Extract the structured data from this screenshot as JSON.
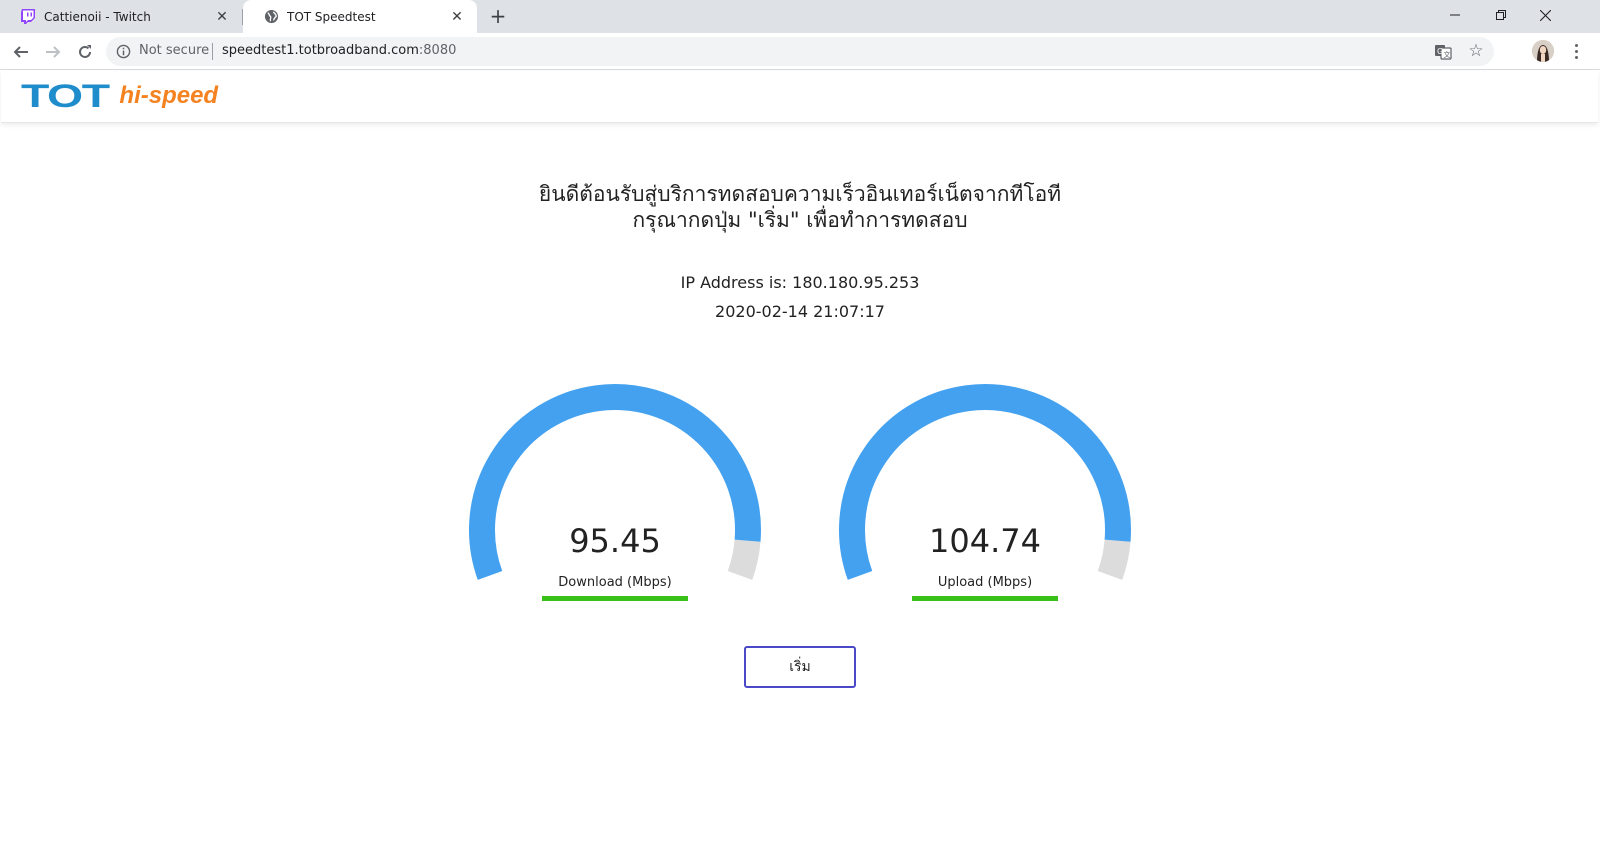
{
  "browser": {
    "tabs": [
      {
        "title": "Cattienoii - Twitch",
        "icon": "twitch-icon",
        "active": false
      },
      {
        "title": "TOT Speedtest",
        "icon": "globe-icon",
        "active": true
      }
    ],
    "new_tab_label": "+",
    "omnibox": {
      "security_label": "Not secure",
      "url_host": "speedtest1.totbroadband.com",
      "url_port": ":8080"
    }
  },
  "site": {
    "logo_primary": "TOT",
    "logo_secondary": "hi-speed",
    "welcome_line1": "ยินดีต้อนรับสู่บริการทดสอบความเร็วอินเทอร์เน็ตจากทีโอที",
    "welcome_line2": "กรุณากดปุ่ม \"เริ่ม\" เพื่อทำการทดสอบ",
    "ip_line": "IP Address is: 180.180.95.253",
    "datetime": "2020-02-14 21:07:17",
    "gauges": [
      {
        "value": "95.45",
        "label": "Download (Mbps)",
        "fill_fraction": 0.93
      },
      {
        "value": "104.74",
        "label": "Upload (Mbps)",
        "fill_fraction": 0.93
      }
    ],
    "start_button_label": "เริ่ม"
  },
  "colors": {
    "gauge_fill": "#43a1ef",
    "gauge_track": "#dcdcdc",
    "gauge_bar": "#39c019",
    "brand_blue": "#1f8ccc",
    "brand_orange": "#f58220",
    "button_border": "#4a4ac8"
  }
}
